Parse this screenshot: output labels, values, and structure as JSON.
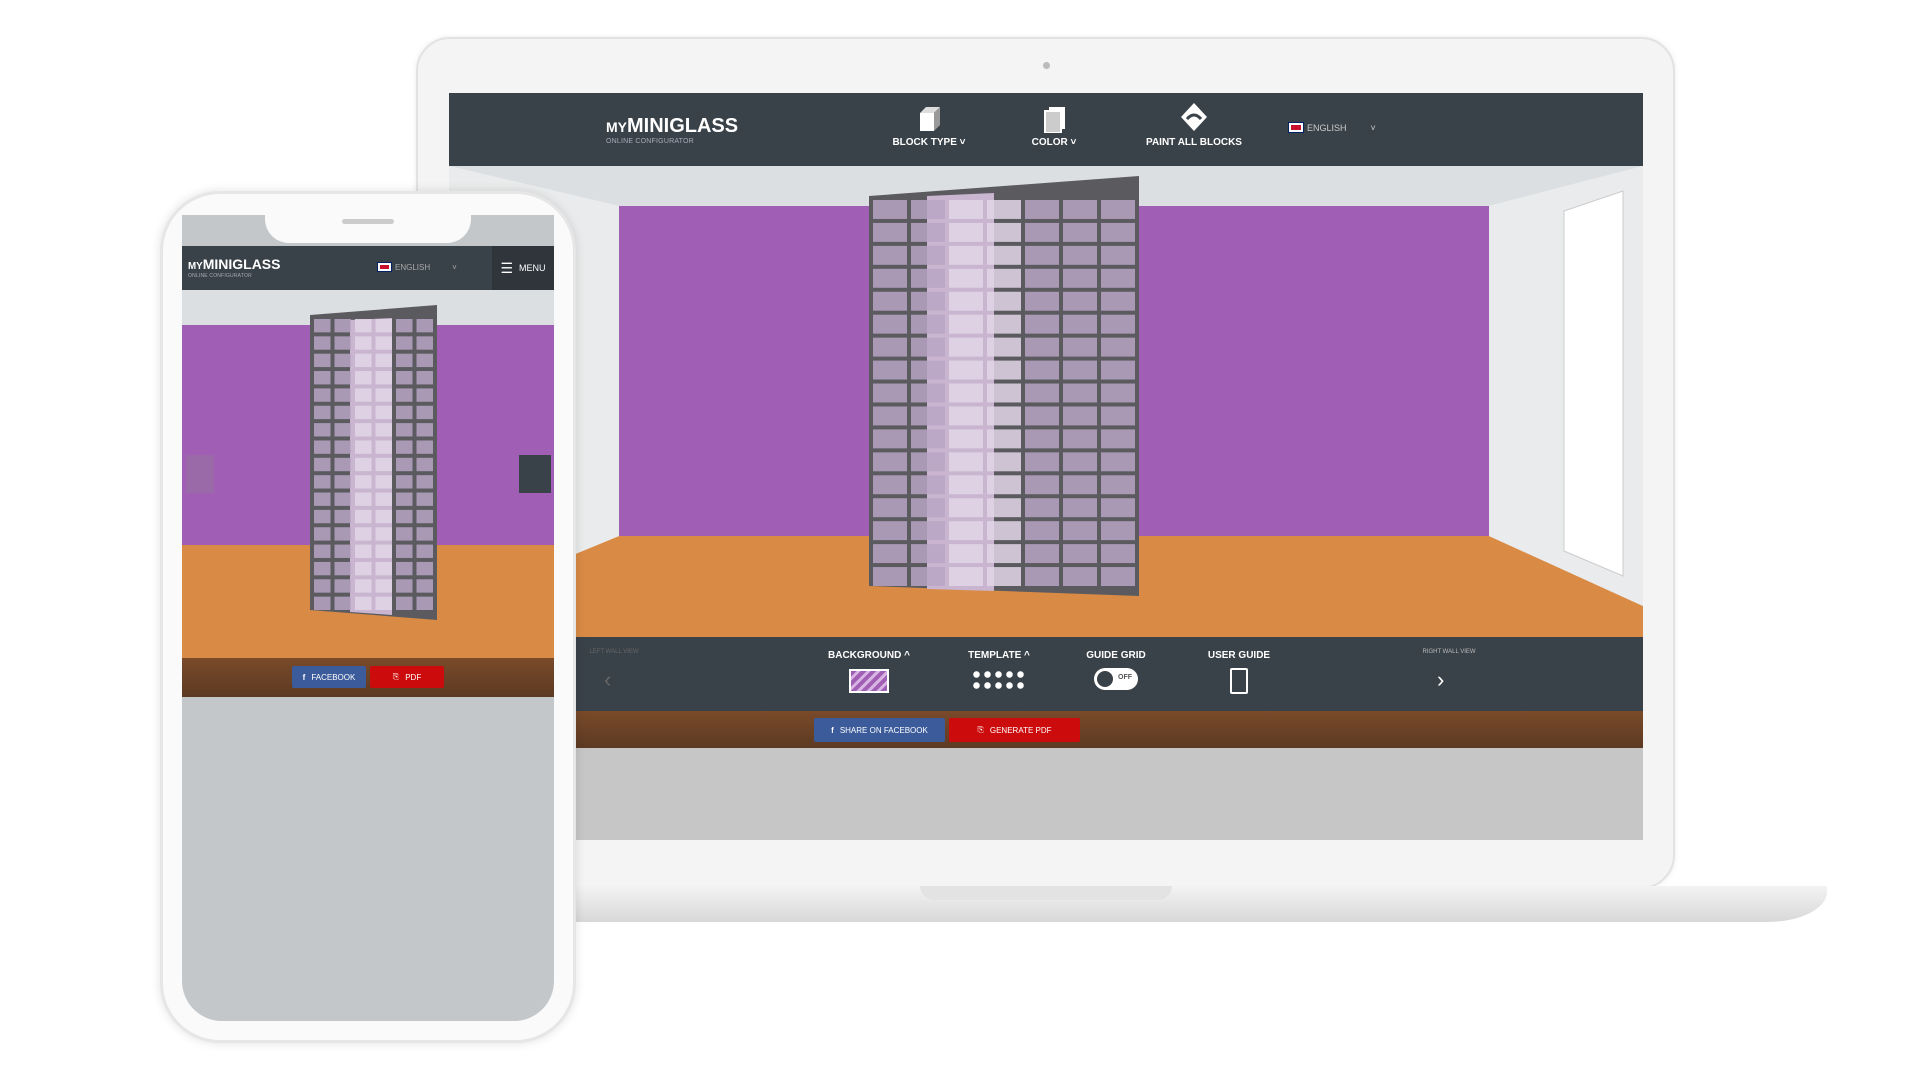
{
  "app": {
    "logo_prefix": "MY",
    "logo_main": "MINIGLASS",
    "logo_sub": "ONLINE CONFIGURATOR"
  },
  "header": {
    "nav": [
      {
        "label": "BLOCK TYPE",
        "icon": "block-icon",
        "dropdown": true
      },
      {
        "label": "COLOR",
        "icon": "color-icon",
        "dropdown": true
      },
      {
        "label": "PAINT ALL BLOCKS",
        "icon": "paint-bucket-icon"
      }
    ],
    "language": "ENGLISH"
  },
  "toolbar": {
    "left_wall": "LEFT WALL VIEW",
    "right_wall": "RIGHT WALL VIEW",
    "items": [
      {
        "label": "BACKGROUND",
        "icon": "background-swatch-icon"
      },
      {
        "label": "TEMPLATE",
        "icon": "template-grid-icon"
      },
      {
        "label": "GUIDE GRID",
        "icon": "toggle-icon",
        "state": "OFF"
      },
      {
        "label": "USER GUIDE",
        "icon": "book-icon"
      }
    ]
  },
  "share": {
    "facebook": "SHARE ON FACEBOOK",
    "pdf": "GENERATE PDF"
  },
  "mobile": {
    "language": "ENGLISH",
    "menu": "MENU",
    "facebook": "FACEBOOK",
    "pdf": "PDF"
  },
  "colors": {
    "header": "#3a4249",
    "wall": "#a05fb5",
    "floor": "#d98a45",
    "facebook": "#3b5b9a",
    "pdf": "#cc0c0c"
  }
}
